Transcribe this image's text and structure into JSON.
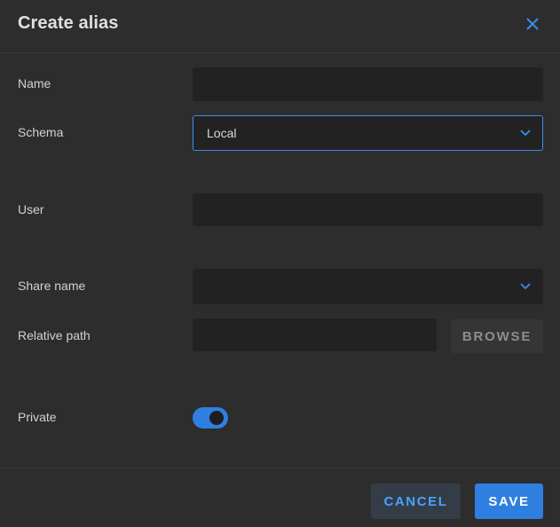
{
  "dialog": {
    "title": "Create alias",
    "close_icon": "close-icon",
    "accent_color": "#2f7fe0"
  },
  "form": {
    "name": {
      "label": "Name",
      "value": ""
    },
    "schema": {
      "label": "Schema",
      "value": "Local",
      "icon": "chevron-down-icon"
    },
    "user": {
      "label": "User",
      "value": ""
    },
    "share_name": {
      "label": "Share name",
      "value": "",
      "icon": "chevron-down-icon"
    },
    "relative_path": {
      "label": "Relative path",
      "value": "",
      "browse_label": "BROWSE"
    },
    "private": {
      "label": "Private",
      "checked": true
    }
  },
  "footer": {
    "cancel_label": "CANCEL",
    "save_label": "SAVE"
  }
}
